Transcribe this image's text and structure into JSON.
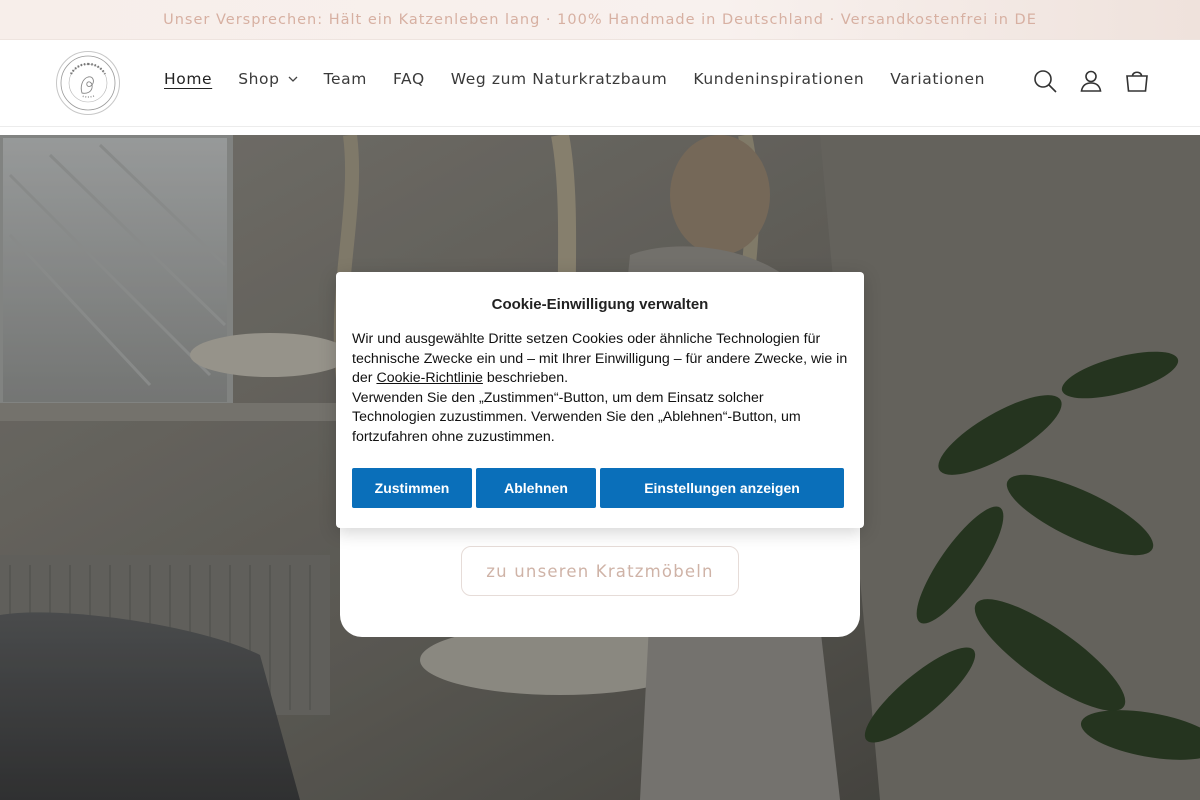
{
  "announcement": {
    "text": "Unser Versprechen: Hält ein Katzenleben lang · 100% Handmade in Deutschland · Versandkostenfrei in DE"
  },
  "header": {
    "logo_icon": "brand-logo-seal",
    "nav": [
      {
        "label": "Home",
        "active": true
      },
      {
        "label": "Shop",
        "has_dropdown": true
      },
      {
        "label": "Team"
      },
      {
        "label": "FAQ"
      },
      {
        "label": "Weg zum Naturkratzbaum"
      },
      {
        "label": "Kundeninspirationen"
      },
      {
        "label": "Variationen"
      }
    ],
    "icons": [
      "search-icon",
      "account-icon",
      "cart-icon"
    ]
  },
  "hero": {
    "button_label": "zu unseren Kratzmöbeln",
    "accent_color": "#cfb3a7"
  },
  "cookie": {
    "title": "Cookie-Einwilligung verwalten",
    "text_part1": "Wir und ausgewählte Dritte setzen Cookies oder ähnliche Technologien für technische Zwecke ein und – mit Ihrer Einwilligung – für andere Zwecke, wie in der ",
    "link_label": "Cookie-Richtlinie",
    "text_part2": " beschrieben.",
    "text_part3": "Verwenden Sie den „Zustimmen“-Button, um dem Einsatz solcher Technologien zuzustimmen. Verwenden Sie den „Ablehnen“-Button, um fortzufahren ohne zuzustimmen.",
    "buttons": {
      "accept": "Zustimmen",
      "reject": "Ablehnen",
      "settings": "Einstellungen anzeigen"
    },
    "button_color": "#0a6fba"
  }
}
